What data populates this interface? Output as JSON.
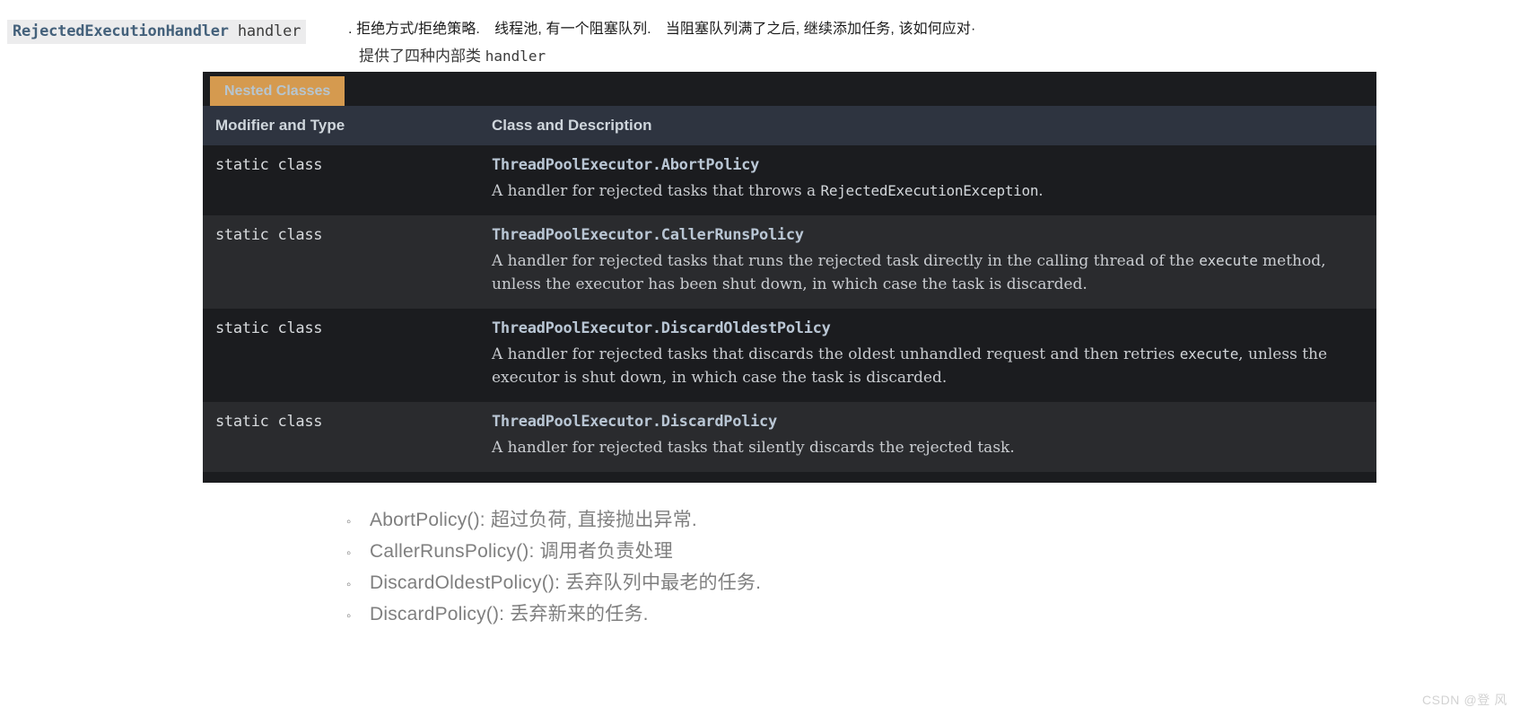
{
  "annotation": {
    "code_chip": {
      "type": "RejectedExecutionHandler",
      "param": "handler"
    },
    "note_line_1": ". 拒绝方式/拒绝策略.　线程池, 有一个阻塞队列.　当阻塞队列满了之后, 继续添加任务, 该如何应对·",
    "note_line_2_prefix": "提供了四种内部类 ",
    "note_line_2_mono": "handler"
  },
  "javadoc": {
    "tab_label": "Nested Classes",
    "columns": {
      "modifier": "Modifier and Type",
      "description": "Class and Description"
    },
    "rows": [
      {
        "modifier": "static class",
        "class_name": "ThreadPoolExecutor.AbortPolicy",
        "desc_parts": [
          {
            "text": "A handler for rejected tasks that throws a ",
            "code": false
          },
          {
            "text": "RejectedExecutionException",
            "code": true
          },
          {
            "text": ".",
            "code": false
          }
        ]
      },
      {
        "modifier": "static class",
        "class_name": "ThreadPoolExecutor.CallerRunsPolicy",
        "desc_parts": [
          {
            "text": "A handler for rejected tasks that runs the rejected task directly in the calling thread of the ",
            "code": false
          },
          {
            "text": "execute",
            "code": true
          },
          {
            "text": " method, unless the executor has been shut down, in which case the task is discarded.",
            "code": false
          }
        ]
      },
      {
        "modifier": "static class",
        "class_name": "ThreadPoolExecutor.DiscardOldestPolicy",
        "desc_parts": [
          {
            "text": "A handler for rejected tasks that discards the oldest unhandled request and then retries ",
            "code": false
          },
          {
            "text": "execute",
            "code": true
          },
          {
            "text": ", unless the executor is shut down, in which case the task is discarded.",
            "code": false
          }
        ]
      },
      {
        "modifier": "static class",
        "class_name": "ThreadPoolExecutor.DiscardPolicy",
        "desc_parts": [
          {
            "text": "A handler for rejected tasks that silently discards the rejected task.",
            "code": false
          }
        ]
      }
    ]
  },
  "policy_list": {
    "marker": "◦",
    "items": [
      "AbortPolicy(): 超过负荷, 直接抛出异常.",
      "CallerRunsPolicy(): 调用者负责处理",
      "DiscardOldestPolicy(): 丢弃队列中最老的任务.",
      "DiscardPolicy(): 丢弃新来的任务."
    ]
  },
  "watermark": "CSDN @登 风",
  "colors": {
    "tab_background": "#d59a4f",
    "tab_text": "#b6c5d0",
    "header_background": "#2e3440",
    "row_dark": "#1b1c1f",
    "row_light": "#2a2b2e",
    "class_name_text": "#b9c6d4",
    "code_chip_type": "#44617b"
  }
}
